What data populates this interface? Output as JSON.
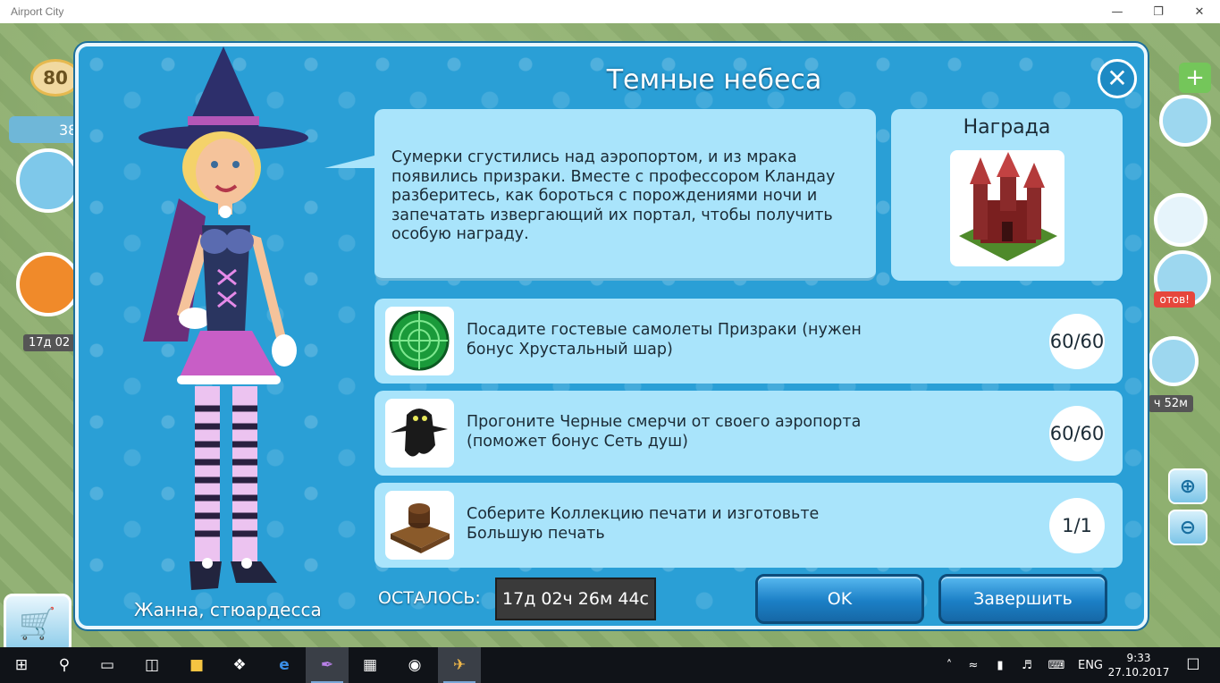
{
  "window": {
    "title": "Airport City"
  },
  "hud": {
    "level": "80",
    "people_count": "38",
    "event_timer": "17д 02",
    "right_badge": "отов!",
    "right_timer": "ч 52м"
  },
  "dialog": {
    "title": "Темные небеса",
    "character_name": "Жанна, стюардесса",
    "speech": "Сумерки сгустились над аэропортом, и из мрака появились призраки. Вместе с профессором Кландау разберитесь, как бороться с порождениями ночи и запечатать извергающий их портал, чтобы получить особую награду.",
    "reward_title": "Награда",
    "tasks": [
      {
        "text": "Посадите гостевые самолеты Призраки (нужен бонус Хрустальный шар)",
        "progress": "60/60",
        "icon": "radar-icon"
      },
      {
        "text": "Прогоните Черные смерчи от своего аэропорта (поможет бонус Сеть душ)",
        "progress": "60/60",
        "icon": "ghost-icon"
      },
      {
        "text": "Соберите Коллекцию печати и изготовьте Большую печать",
        "progress": "1/1",
        "icon": "seal-icon"
      }
    ],
    "remaining_label": "ОСТАЛОСЬ:",
    "timer": "17д 02ч 26м 44с",
    "ok_label": "OK",
    "finish_label": "Завершить"
  },
  "taskbar": {
    "language": "ENG",
    "time": "9:33",
    "date": "27.10.2017"
  },
  "colors": {
    "dialog_blue": "#2a9fd6",
    "panel_blue": "#a9e4fb",
    "button_blue": "#1b7fc6"
  }
}
